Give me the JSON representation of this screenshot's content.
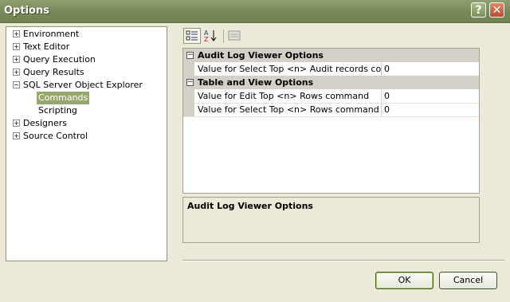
{
  "window": {
    "title": "Options"
  },
  "tree": {
    "items": [
      {
        "label": "Environment",
        "expandable": true,
        "indent": 0
      },
      {
        "label": "Text Editor",
        "expandable": true,
        "indent": 0
      },
      {
        "label": "Query Execution",
        "expandable": true,
        "indent": 0
      },
      {
        "label": "Query Results",
        "expandable": true,
        "indent": 0
      },
      {
        "label": "SQL Server Object Explorer",
        "expandable": true,
        "indent": 0
      },
      {
        "label": "Commands",
        "expandable": false,
        "indent": 1,
        "selected": true
      },
      {
        "label": "Scripting",
        "expandable": false,
        "indent": 1
      },
      {
        "label": "Designers",
        "expandable": true,
        "indent": 0
      },
      {
        "label": "Source Control",
        "expandable": true,
        "indent": 0
      }
    ]
  },
  "toolbar": {
    "buttons": [
      {
        "icon": "categorized-icon",
        "active": true
      },
      {
        "icon": "sort-alphabetical-icon",
        "active": false
      },
      {
        "icon": "property-pages-icon",
        "active": false
      }
    ]
  },
  "grid": {
    "categories": [
      {
        "label": "Audit Log Viewer Options",
        "properties": [
          {
            "name": "Value for Select Top <n> Audit records command",
            "value": "0"
          }
        ]
      },
      {
        "label": "Table and View Options",
        "properties": [
          {
            "name": "Value for Edit Top <n> Rows command",
            "value": "0"
          },
          {
            "name": "Value for Select Top <n> Rows command",
            "value": "0"
          }
        ]
      }
    ]
  },
  "description": {
    "title": "Audit Log Viewer Options"
  },
  "buttons": {
    "ok": "OK",
    "cancel": "Cancel"
  },
  "colors": {
    "titlebar": "#7a8c5c",
    "selection": "#96a86b",
    "background": "#ece9d8"
  }
}
